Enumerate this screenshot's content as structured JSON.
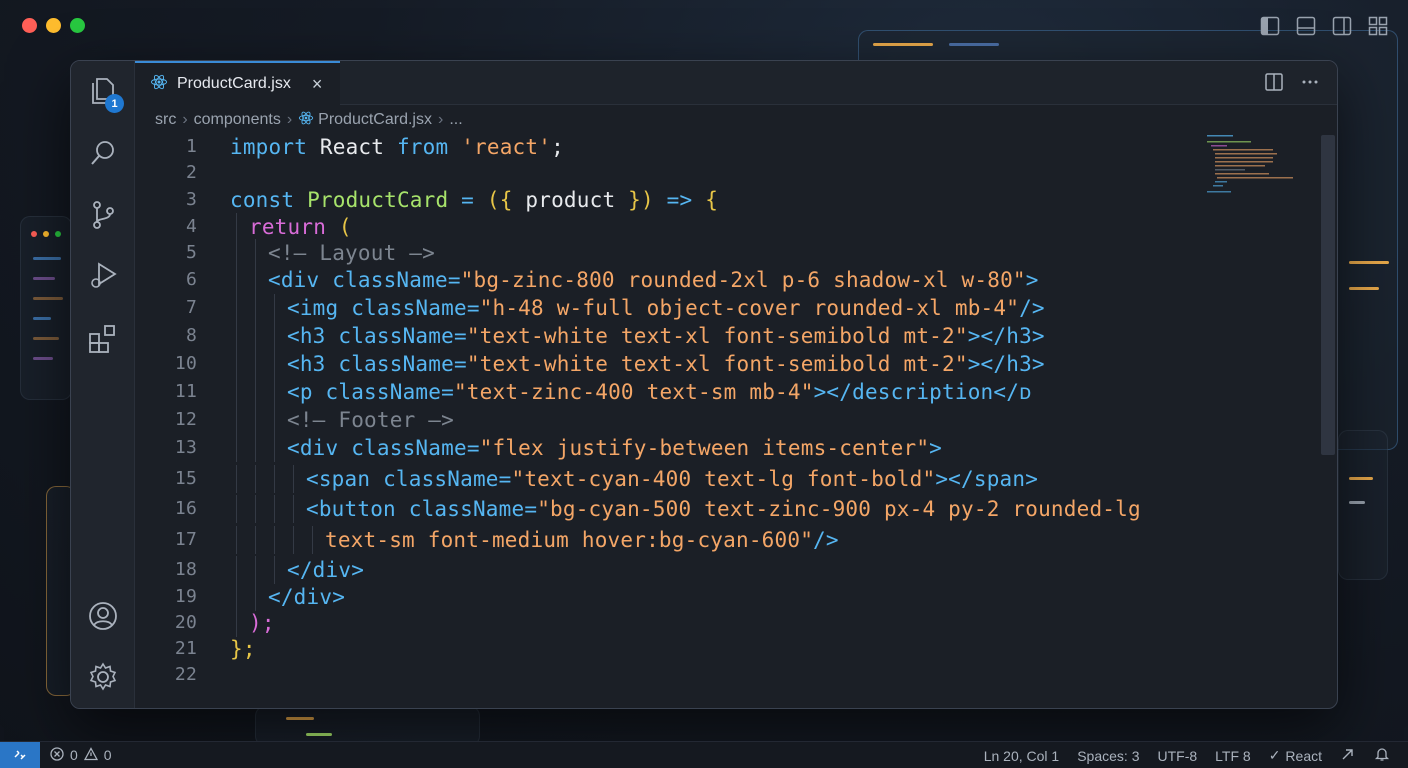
{
  "tab": {
    "filename": "ProductCard.jsx",
    "close": "×"
  },
  "breadcrumb": [
    "src",
    "components",
    "ProductCard.jsx",
    "..."
  ],
  "activity": {
    "badge_count": "1"
  },
  "code": {
    "lines": [
      {
        "n": "1",
        "indent": 0,
        "tokens": [
          [
            "import",
            "k"
          ],
          [
            " React ",
            "n"
          ],
          [
            "from",
            "k"
          ],
          [
            " ",
            "n"
          ],
          [
            "'react'",
            "s"
          ],
          [
            ";",
            "n"
          ]
        ]
      },
      {
        "n": "2",
        "indent": 0,
        "tokens": []
      },
      {
        "n": "3",
        "indent": 0,
        "tokens": [
          [
            "const",
            "k"
          ],
          [
            " ",
            "n"
          ],
          [
            "ProductCard",
            "f"
          ],
          [
            " = ",
            "o"
          ],
          [
            "({",
            "y"
          ],
          [
            " product ",
            "n"
          ],
          [
            "})",
            "y"
          ],
          [
            " => ",
            "o"
          ],
          [
            "{",
            "y"
          ]
        ]
      },
      {
        "n": "4",
        "indent": 1,
        "tokens": [
          [
            "return",
            "p"
          ],
          [
            " (",
            "y"
          ]
        ]
      },
      {
        "n": "5",
        "indent": 2,
        "tokens": [
          [
            "<!— Layout —>",
            "c"
          ]
        ]
      },
      {
        "n": "6",
        "indent": 2,
        "tokens": [
          [
            "<div ",
            "t"
          ],
          [
            "className",
            "a"
          ],
          [
            "=",
            "o"
          ],
          [
            "\"bg-zinc-800 rounded-2xl p-6 shadow-xl w-80\"",
            "s"
          ],
          [
            ">",
            "t"
          ]
        ]
      },
      {
        "n": "7",
        "indent": 3,
        "tokens": [
          [
            "<img ",
            "t"
          ],
          [
            "className",
            "a"
          ],
          [
            "=",
            "o"
          ],
          [
            "\"h-48 w-full object-cover rounded-xl mb-4\"",
            "s"
          ],
          [
            "/>",
            "t"
          ]
        ]
      },
      {
        "n": "8",
        "indent": 3,
        "tokens": [
          [
            "<h3 ",
            "t"
          ],
          [
            "className",
            "a"
          ],
          [
            "=",
            "o"
          ],
          [
            "\"text-white text-xl font-semibold mt-2\"",
            "s"
          ],
          [
            "></h3>",
            "t"
          ]
        ]
      },
      {
        "n": "10",
        "indent": 3,
        "tokens": [
          [
            "<h3 ",
            "t"
          ],
          [
            "className",
            "a"
          ],
          [
            "=",
            "o"
          ],
          [
            "\"text-white text-xl font-semibold mt-2\"",
            "s"
          ],
          [
            "></h3>",
            "t"
          ]
        ]
      },
      {
        "n": "11",
        "indent": 3,
        "tokens": [
          [
            "<p ",
            "t"
          ],
          [
            "className",
            "a"
          ],
          [
            "=",
            "o"
          ],
          [
            "\"text-zinc-400 text-sm mb-4\"",
            "s"
          ],
          [
            "></description</ᴅ",
            "t"
          ]
        ]
      },
      {
        "n": "12",
        "indent": 3,
        "tokens": [
          [
            "<!— Footer —>",
            "c"
          ]
        ]
      },
      {
        "n": "13",
        "indent": 3,
        "tokens": [
          [
            "<div ",
            "t"
          ],
          [
            "className",
            "a"
          ],
          [
            "=",
            "o"
          ],
          [
            "\"flex justify-between items-center\"",
            "s"
          ],
          [
            ">",
            "t"
          ]
        ]
      },
      {
        "n": "15",
        "indent": 4,
        "tokens": [
          [
            "<span ",
            "t"
          ],
          [
            "className",
            "a"
          ],
          [
            "=",
            "o"
          ],
          [
            "\"text-cyan-400 text-lg font-bold\"",
            "s"
          ],
          [
            "></span>",
            "t"
          ]
        ]
      },
      {
        "n": "16",
        "indent": 4,
        "tokens": [
          [
            "<button ",
            "t"
          ],
          [
            "className",
            "a"
          ],
          [
            "=",
            "o"
          ],
          [
            "\"bg-cyan-500 text-zinc-900 px-4 py-2 rounded-lg",
            "s"
          ]
        ]
      },
      {
        "n": "17",
        "indent": 5,
        "tokens": [
          [
            "text-sm font-medium hover:bg-cyan-600\"",
            "s"
          ],
          [
            "/>",
            "t"
          ]
        ]
      },
      {
        "n": "18",
        "indent": 3,
        "tokens": [
          [
            "</div>",
            "t"
          ]
        ]
      },
      {
        "n": "19",
        "indent": 2,
        "tokens": [
          [
            "</div>",
            "t"
          ]
        ]
      },
      {
        "n": "20",
        "indent": 1,
        "tokens": [
          [
            ");",
            "p"
          ]
        ]
      },
      {
        "n": "21",
        "indent": 0,
        "tokens": [
          [
            "};",
            "y"
          ]
        ]
      },
      {
        "n": "22",
        "indent": 0,
        "tokens": []
      }
    ]
  },
  "status": {
    "errors": "0",
    "warnings": "0",
    "position": "Ln 20, Col 1",
    "spaces": "Spaces: 3",
    "encoding": "UTF-8",
    "eol": "LTF 8",
    "language": "React"
  },
  "colors": {
    "accent": "#3a8bd6",
    "keyword": "#56b6f2",
    "string": "#f4a667",
    "function": "#a7e36b",
    "bracket": "#e7c547",
    "return": "#d96cd8",
    "comment": "#7d8590"
  },
  "icons": {
    "activity": [
      "explorer-icon",
      "search-icon",
      "source-control-icon",
      "run-debug-icon",
      "extensions-icon",
      "account-icon",
      "settings-icon"
    ],
    "tab": "react-icon",
    "tab_actions": [
      "split-editor-icon",
      "more-actions-icon"
    ],
    "window": [
      "toggle-sidebar-icon",
      "toggle-panel-icon",
      "toggle-secondary-sidebar-icon",
      "customize-layout-icon"
    ],
    "status": [
      "remote-icon",
      "error-icon",
      "warning-icon",
      "check-icon",
      "copilot-icon",
      "bell-icon"
    ]
  }
}
